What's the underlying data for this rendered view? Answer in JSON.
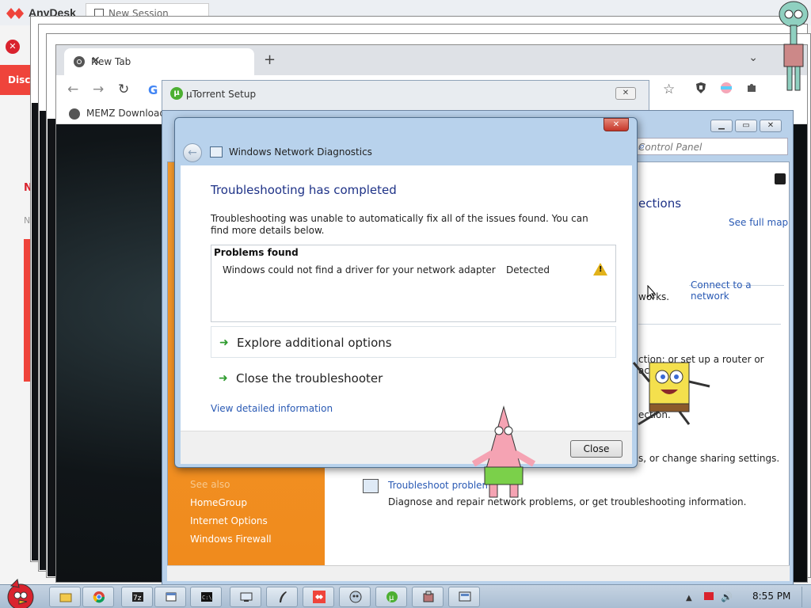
{
  "anydesk": {
    "app_name": "AnyDesk",
    "session_tab": "New Session",
    "disconnect_partial": "Disc",
    "side_initial": "N",
    "side_initial2": "N"
  },
  "chrome": {
    "tab_title": "New Tab",
    "bookmark": "MEMZ Download",
    "omnibox_initial": "G"
  },
  "utorrent": {
    "title": "µTorrent Setup"
  },
  "control_panel": {
    "search_placeholder": "Control Panel",
    "heading_partial": "ections",
    "see_full_map": "See full map",
    "connect_to_network": "Connect to a network",
    "text_works": "works.",
    "text_router": "ction; or set up a router or access",
    "text_connection": "ection.",
    "text_sharing": "s, or change sharing settings.",
    "troubleshoot_title": "Troubleshoot problems",
    "troubleshoot_desc": "Diagnose and repair network problems, or get troubleshooting information.",
    "sidebar": {
      "see_also": "See also",
      "items": [
        "HomeGroup",
        "Internet Options",
        "Windows Firewall"
      ]
    }
  },
  "dialog": {
    "title": "Windows Network Diagnostics",
    "heading": "Troubleshooting has completed",
    "description": "Troubleshooting was unable to automatically fix all of the issues found. You can find more details below.",
    "problems_header": "Problems found",
    "problem": {
      "text": "Windows could not find a driver for your network adapter",
      "status": "Detected"
    },
    "options": [
      "Explore additional options",
      "Close the troubleshooter"
    ],
    "detail_link": "View detailed information",
    "close_button": "Close"
  },
  "taskbar": {
    "clock": "8:55 PM",
    "apps": [
      "explorer",
      "chrome",
      "7-zip",
      "file-manager",
      "cmd",
      "network",
      "quill",
      "anydesk",
      "memz",
      "utorrent",
      "tools",
      "control-panel"
    ]
  },
  "colors": {
    "dialog_heading": "#1e3287",
    "link": "#2a5ab4",
    "sidebar_orange": "#f08a1c",
    "anydesk_red": "#ef443b"
  }
}
